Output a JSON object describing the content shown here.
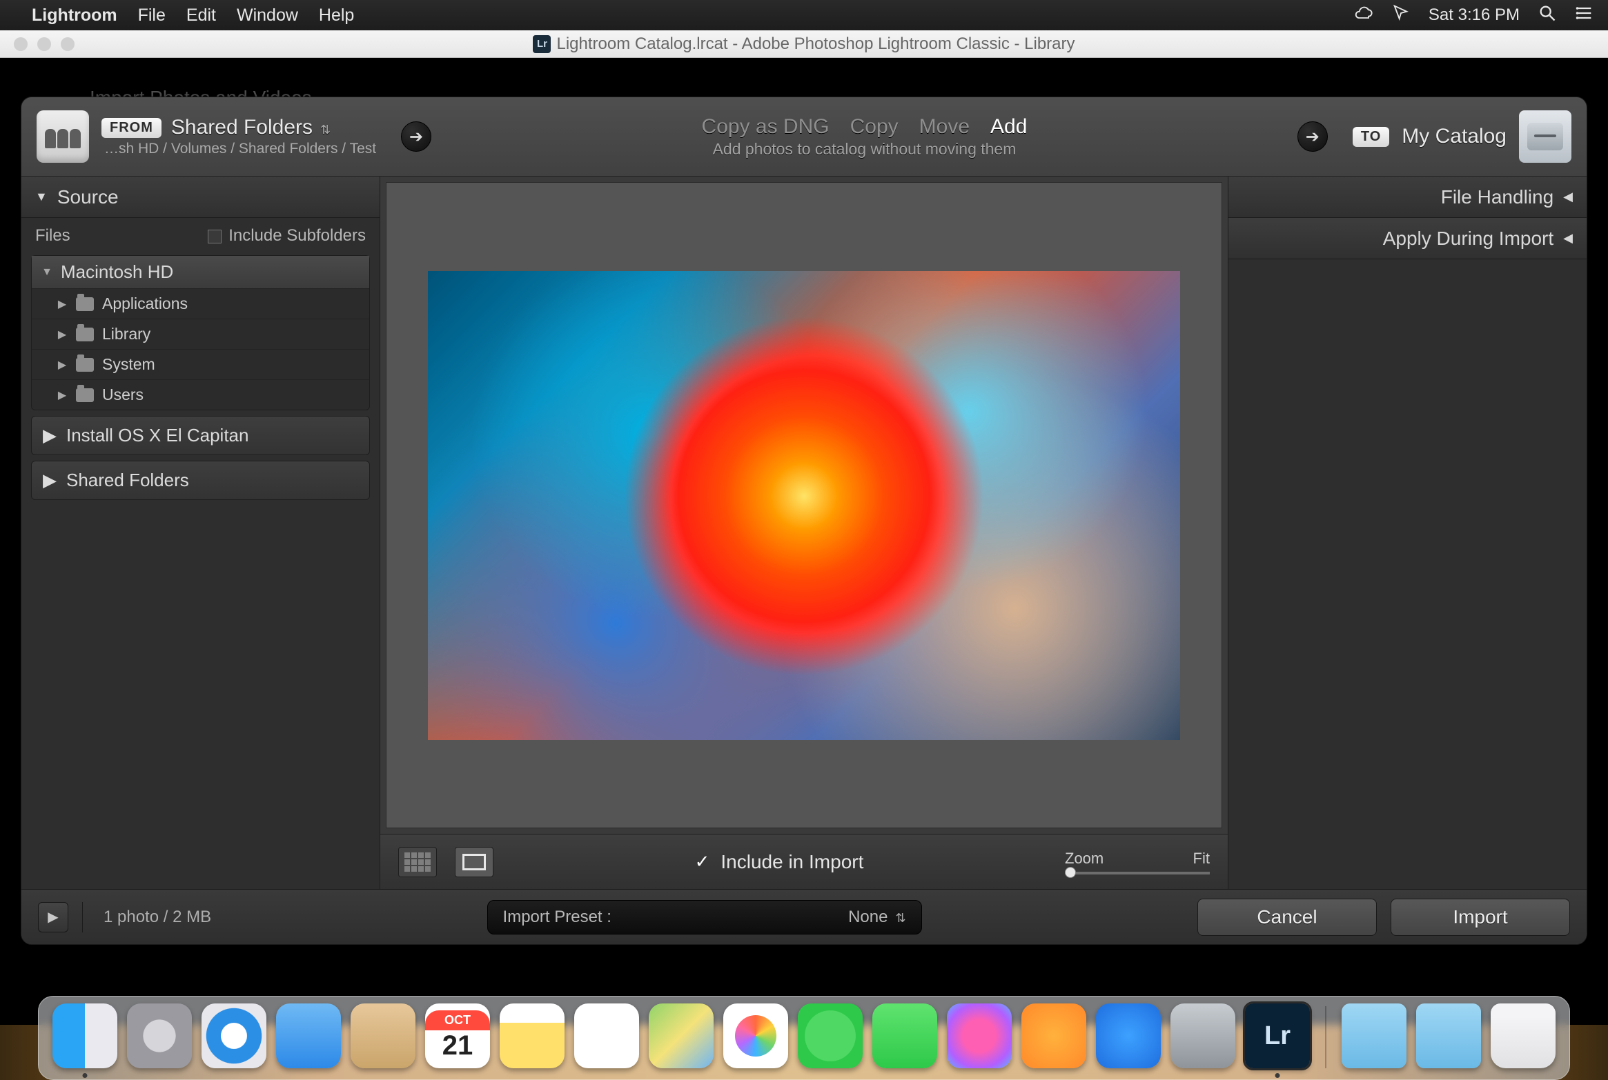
{
  "menubar": {
    "app": "Lightroom",
    "items": [
      "File",
      "Edit",
      "Window",
      "Help"
    ],
    "clock": "Sat 3:16 PM"
  },
  "titlebar": {
    "title": "Lightroom Catalog.lrcat - Adobe Photoshop Lightroom Classic - Library"
  },
  "hidden_dialog_label": "Import Photos and Videos",
  "header": {
    "from_badge": "FROM",
    "from_title": "Shared Folders",
    "from_path": "…sh HD / Volumes / Shared Folders / Test",
    "modes": {
      "copy_dng": "Copy as DNG",
      "copy": "Copy",
      "move": "Move",
      "add": "Add"
    },
    "mode_sub": "Add photos to catalog without moving them",
    "to_badge": "TO",
    "to_title": "My Catalog"
  },
  "left": {
    "title": "Source",
    "files_label": "Files",
    "include_subfolders": "Include Subfolders",
    "root": "Macintosh HD",
    "children": [
      "Applications",
      "Library",
      "System",
      "Users"
    ],
    "volumes": [
      "Install OS X El Capitan",
      "Shared Folders"
    ]
  },
  "right": {
    "file_handling": "File Handling",
    "apply_during_import": "Apply During Import"
  },
  "center": {
    "include_label": "Include in Import",
    "zoom_label": "Zoom",
    "fit_label": "Fit"
  },
  "footer": {
    "status": "1 photo / 2 MB",
    "preset_label": "Import Preset :",
    "preset_value": "None",
    "cancel": "Cancel",
    "import": "Import"
  },
  "dock": {
    "calendar_month": "OCT",
    "calendar_day": "21",
    "lr_label": "Lr"
  }
}
